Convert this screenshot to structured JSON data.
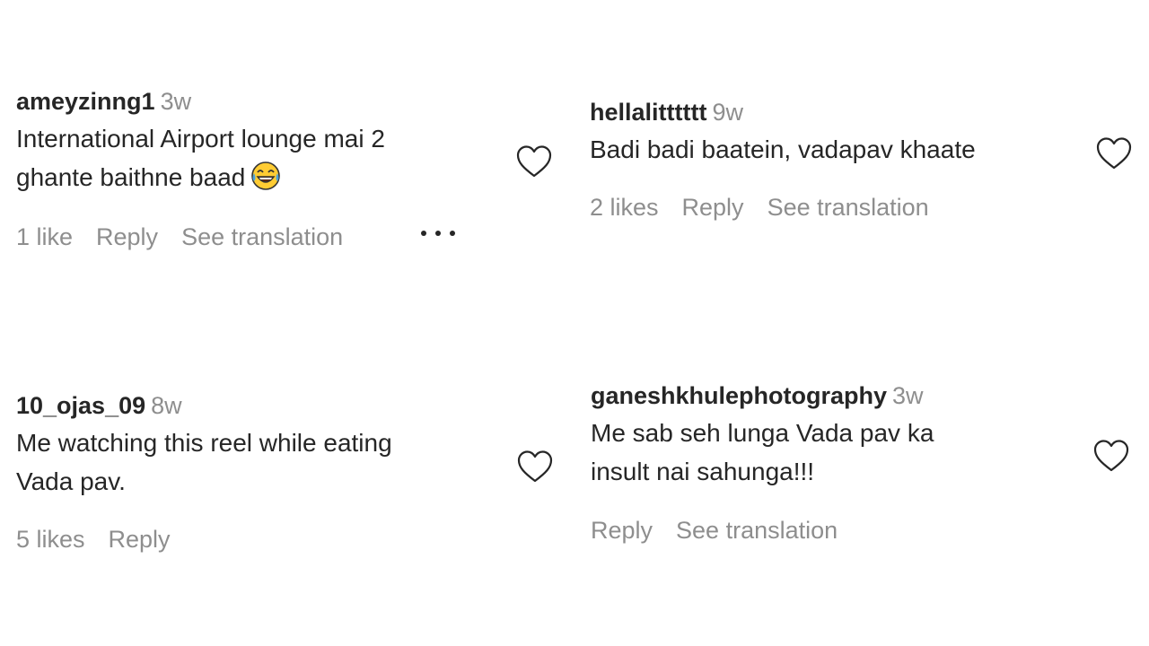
{
  "comments": [
    {
      "username": "ameyzinng1",
      "time": "3w",
      "line1": "International Airport lounge mai 2",
      "line2": "ghante baithne baad",
      "emoji": "tears-of-joy-emoji",
      "likes": "1 like",
      "reply": "Reply",
      "translate": "See translation",
      "more_icon": "more-options-icon"
    },
    {
      "username": "hellalitttttt",
      "time": "9w",
      "line1": "Badi badi baatein, vadapav khaate",
      "likes": "2 likes",
      "reply": "Reply",
      "translate": "See translation"
    },
    {
      "username": "10_ojas_09",
      "time": "8w",
      "line1": "Me watching this reel while eating",
      "line2": "Vada pav.",
      "likes": "5 likes",
      "reply": "Reply"
    },
    {
      "username": "ganeshkhulephotography",
      "time": "3w",
      "line1": "Me sab seh lunga Vada pav ka",
      "line2": "insult nai sahunga!!!",
      "reply": "Reply",
      "translate": "See translation"
    }
  ],
  "icons": {
    "like": "heart-icon"
  },
  "colors": {
    "text": "#262626",
    "secondary": "#8e8e8e",
    "background": "#ffffff"
  }
}
